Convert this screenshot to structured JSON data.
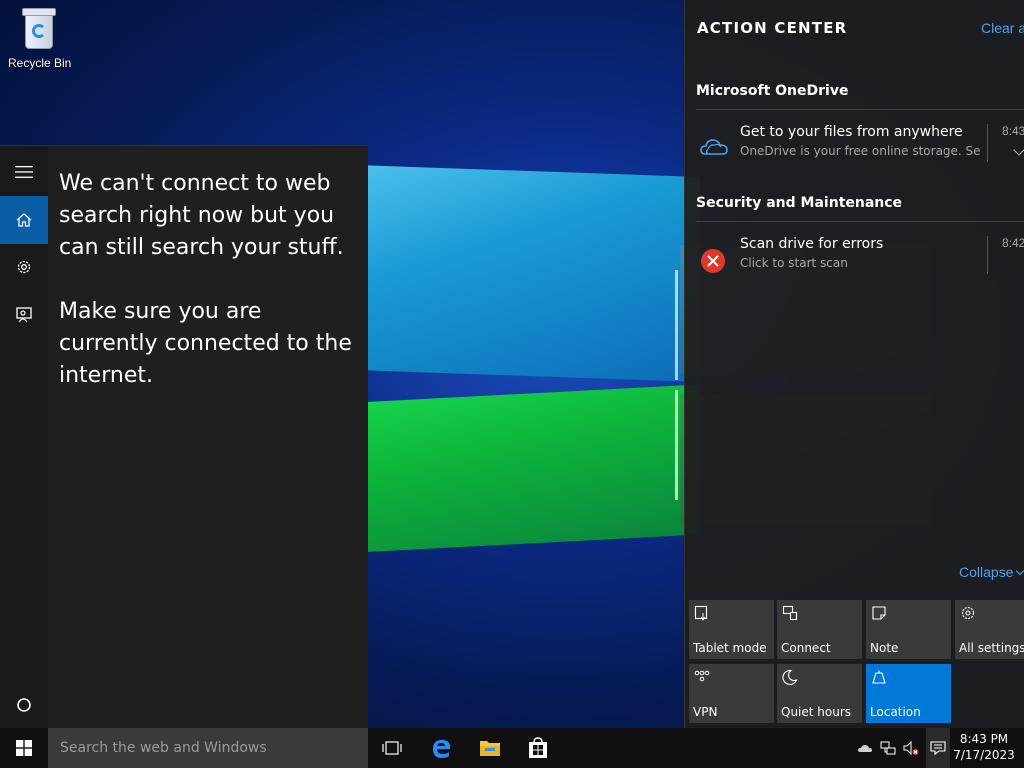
{
  "desktop": {
    "recycle_bin_label": "Recycle Bin"
  },
  "start_panel": {
    "rail": {
      "menu_icon": "hamburger-icon",
      "home_icon": "home-icon",
      "settings_icon": "gear-icon",
      "feedback_icon": "feedback-icon",
      "cortana_icon": "circle-icon"
    },
    "message_line1": "We can't connect to web search right now but you can still search your stuff.",
    "message_line2": "Make sure you are currently connected to the internet."
  },
  "action_center": {
    "title": "ACTION CENTER",
    "clear_all": "Clear a",
    "groups": [
      {
        "header": "Microsoft OneDrive",
        "notifications": [
          {
            "icon": "onedrive-cloud-icon",
            "title": "Get to your files from anywhere",
            "body": "OneDrive is your free online storage. Set",
            "time": "8:43"
          }
        ]
      },
      {
        "header": "Security and Maintenance",
        "notifications": [
          {
            "icon": "error-x-icon",
            "title": "Scan drive for errors",
            "body": "Click to start scan",
            "time": "8:42"
          }
        ]
      }
    ],
    "collapse_label": "Collapse",
    "quick_actions": [
      {
        "label": "Tablet mode",
        "icon": "tablet-mode-icon",
        "on": false
      },
      {
        "label": "Connect",
        "icon": "connect-icon",
        "on": false
      },
      {
        "label": "Note",
        "icon": "note-icon",
        "on": false
      },
      {
        "label": "All settings",
        "icon": "gear-icon",
        "on": false
      },
      {
        "label": "VPN",
        "icon": "vpn-icon",
        "on": false
      },
      {
        "label": "Quiet hours",
        "icon": "moon-icon",
        "on": false
      },
      {
        "label": "Location",
        "icon": "location-icon",
        "on": true
      }
    ],
    "accent_color": "#0078d7",
    "link_color": "#4aa3ef"
  },
  "taskbar": {
    "search_placeholder": "Search the web and Windows",
    "time": "8:43 PM",
    "date": "7/17/2023",
    "pinned": [
      "task-view-icon",
      "edge-icon",
      "file-explorer-icon",
      "store-icon"
    ],
    "tray": [
      "onedrive-tray-icon",
      "network-icon",
      "volume-muted-icon",
      "action-center-icon"
    ]
  }
}
